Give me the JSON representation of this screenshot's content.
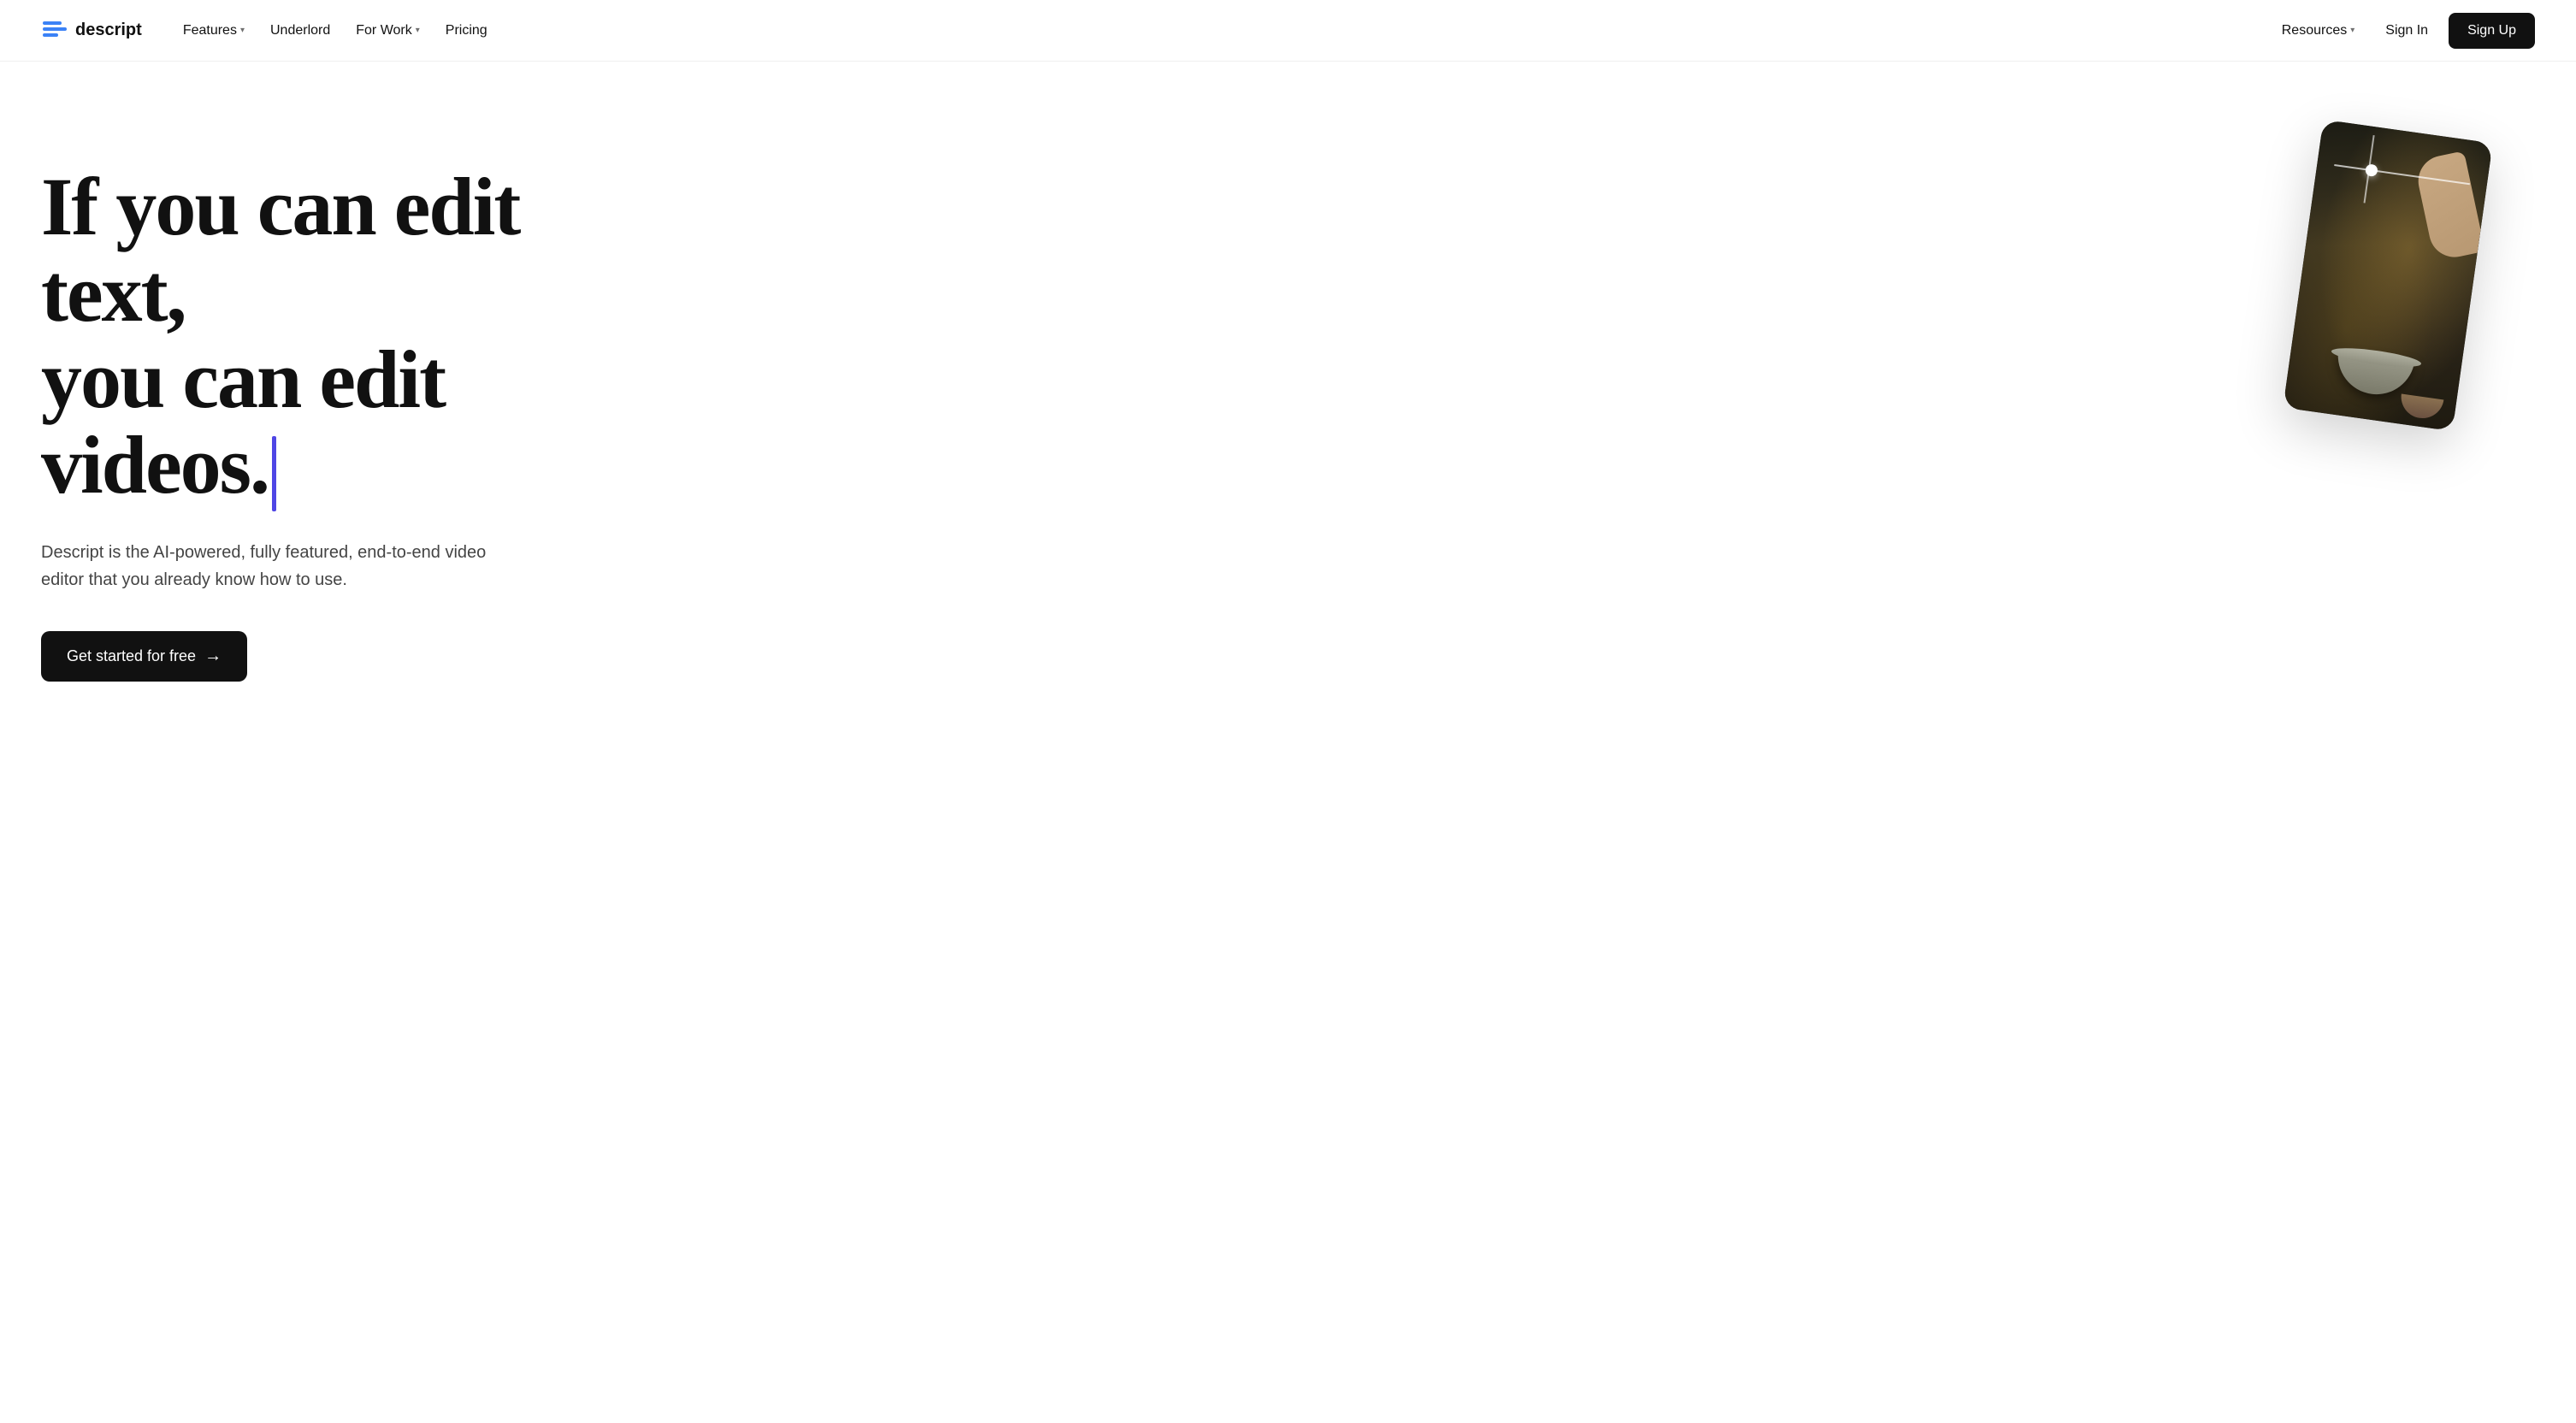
{
  "logo": {
    "text": "descript"
  },
  "nav": {
    "links": [
      {
        "id": "features",
        "label": "Features",
        "hasChevron": true
      },
      {
        "id": "underlord",
        "label": "Underlord",
        "hasChevron": false
      },
      {
        "id": "for-work",
        "label": "For Work",
        "hasChevron": true
      },
      {
        "id": "pricing",
        "label": "Pricing",
        "hasChevron": false
      }
    ],
    "right": [
      {
        "id": "resources",
        "label": "Resources",
        "hasChevron": true
      },
      {
        "id": "signin",
        "label": "Sign In",
        "hasChevron": false
      },
      {
        "id": "signup",
        "label": "Sign Up",
        "hasChevron": false
      }
    ]
  },
  "hero": {
    "headline_line1": "If you can edit text,",
    "headline_line2": "you can edit videos.",
    "subtext": "Descript is the AI-powered, fully featured, end-to-end video editor that you already know how to use.",
    "cta_label": "Get started for free",
    "cta_arrow": "→"
  },
  "colors": {
    "cursor": "#4f46e5",
    "cta_bg": "#111111",
    "signup_bg": "#111111",
    "nav_bg": "#ffffff",
    "text_primary": "#111111",
    "text_secondary": "#444444"
  }
}
